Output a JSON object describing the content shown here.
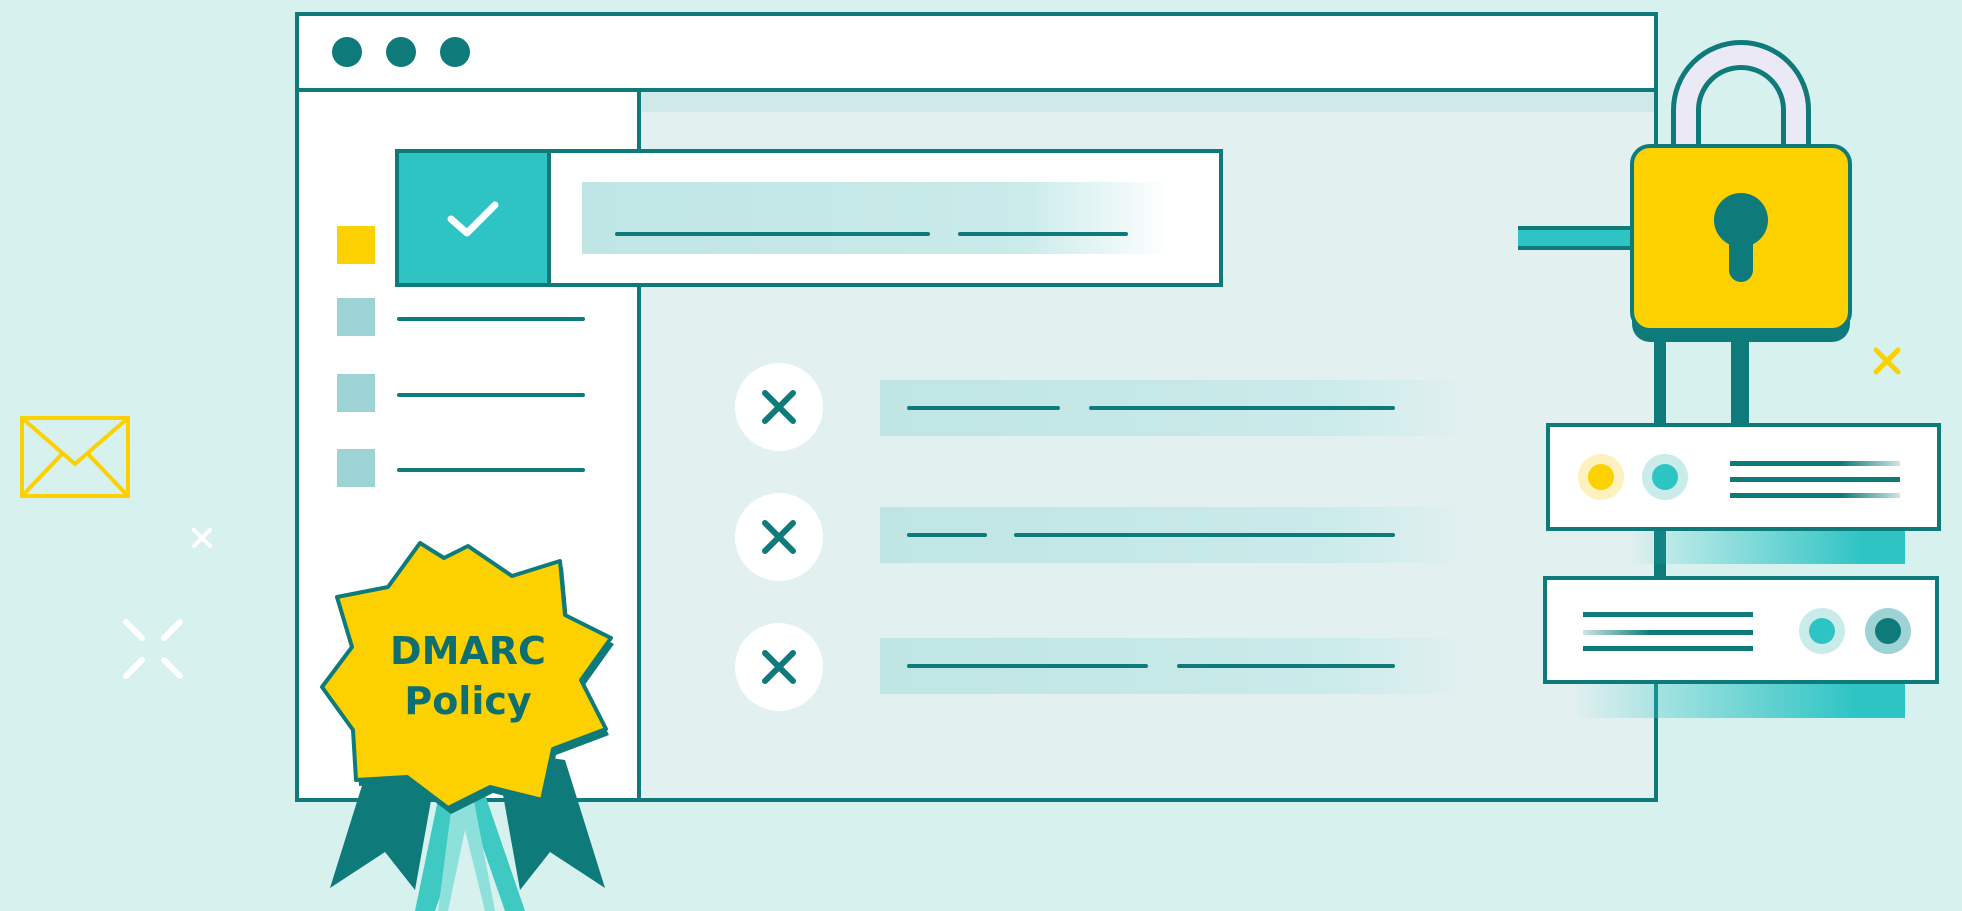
{
  "badge": {
    "line1": "DMARC",
    "line2": "Policy"
  },
  "icons": {
    "envelope": "envelope-icon",
    "padlock": "padlock-icon",
    "check": "check-icon",
    "cross": "x-icon",
    "window_dots": "window-control-dots",
    "sparkle": "sparkle-icon"
  },
  "colors": {
    "background": "#d6f1ee",
    "teal_dark": "#0e7a7a",
    "teal_bright": "#2fc4c4",
    "teal_light": "#c9ebea",
    "yellow": "#fdd000",
    "white": "#ffffff"
  }
}
